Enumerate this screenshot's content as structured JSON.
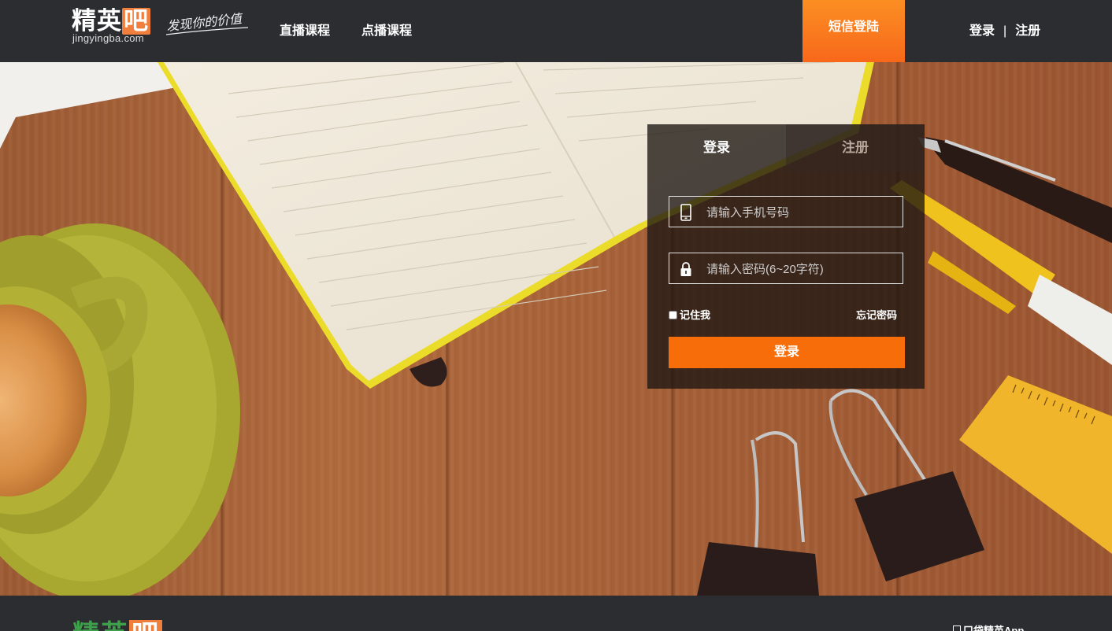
{
  "header": {
    "logo_text": "精英吧",
    "logo_domain": "jingyingba.com",
    "slogan": "发现你的价值",
    "nav": [
      {
        "label": "直播课程"
      },
      {
        "label": "点播课程"
      }
    ],
    "sms_login_label": "短信登陆",
    "login_link": "登录",
    "separator": "|",
    "register_link": "注册"
  },
  "login_panel": {
    "tabs": [
      {
        "label": "登录",
        "active": true
      },
      {
        "label": "注册",
        "active": false
      }
    ],
    "phone_placeholder": "请输入手机号码",
    "password_placeholder": "请输入密码(6~20字符)",
    "remember_label": "记住我",
    "forgot_label": "忘记密码",
    "submit_label": "登录"
  },
  "footer": {
    "logo_text": "精英吧",
    "app_label": "口袋精英App"
  },
  "colors": {
    "header_bg": "#2c2d31",
    "accent_orange": "#f76d0a",
    "logo_orange": "#f07f3e",
    "footer_logo_green": "#3ea04a"
  },
  "icons": [
    "phone-icon",
    "lock-icon",
    "checkbox"
  ]
}
